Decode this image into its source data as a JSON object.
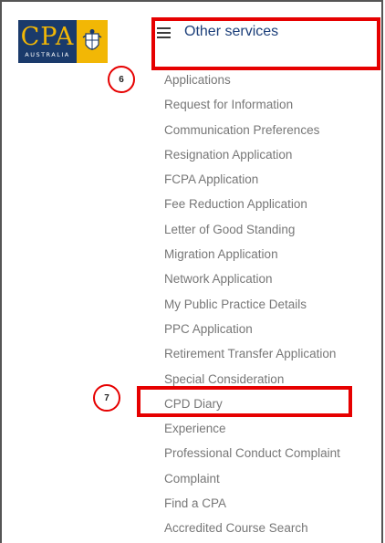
{
  "logo": {
    "main_text": "CPA",
    "sub_text": "AUSTRALIA"
  },
  "header": {
    "title": "Other services"
  },
  "annotations": {
    "step6": "6",
    "step7": "7",
    "highlight_color": "#e60000"
  },
  "menu": {
    "items": [
      "Applications",
      "Request for Information",
      "Communication Preferences",
      "Resignation Application",
      "FCPA Application",
      "Fee Reduction Application",
      "Letter of Good Standing",
      "Migration Application",
      "Network Application",
      "My Public Practice Details",
      "PPC Application",
      "Retirement Transfer Application",
      "Special Consideration",
      "CPD Diary",
      "Experience",
      "Professional Conduct Complaint",
      "Complaint",
      "Find a CPA",
      "Accredited Course Search"
    ]
  },
  "colors": {
    "brand_blue": "#1a3a6b",
    "brand_yellow": "#f2b705",
    "title_blue": "#1c3f7a",
    "menu_text": "#777777"
  }
}
